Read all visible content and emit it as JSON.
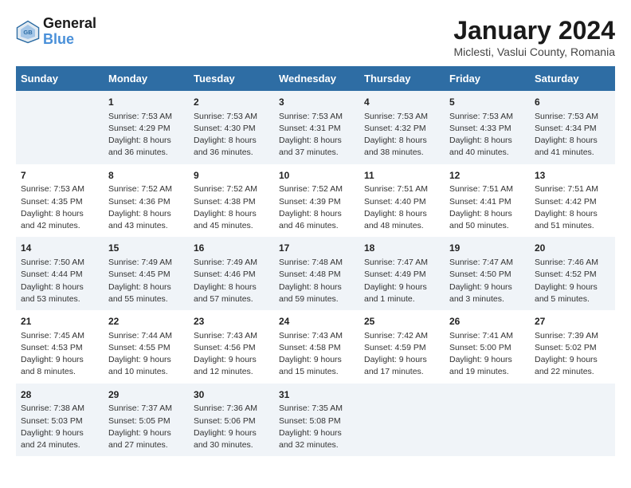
{
  "logo": {
    "line1": "General",
    "line2": "Blue"
  },
  "title": "January 2024",
  "subtitle": "Miclesti, Vaslui County, Romania",
  "header_color": "#2e6da4",
  "days_of_week": [
    "Sunday",
    "Monday",
    "Tuesday",
    "Wednesday",
    "Thursday",
    "Friday",
    "Saturday"
  ],
  "weeks": [
    [
      {
        "day": "",
        "info": ""
      },
      {
        "day": "1",
        "info": "Sunrise: 7:53 AM\nSunset: 4:29 PM\nDaylight: 8 hours\nand 36 minutes."
      },
      {
        "day": "2",
        "info": "Sunrise: 7:53 AM\nSunset: 4:30 PM\nDaylight: 8 hours\nand 36 minutes."
      },
      {
        "day": "3",
        "info": "Sunrise: 7:53 AM\nSunset: 4:31 PM\nDaylight: 8 hours\nand 37 minutes."
      },
      {
        "day": "4",
        "info": "Sunrise: 7:53 AM\nSunset: 4:32 PM\nDaylight: 8 hours\nand 38 minutes."
      },
      {
        "day": "5",
        "info": "Sunrise: 7:53 AM\nSunset: 4:33 PM\nDaylight: 8 hours\nand 40 minutes."
      },
      {
        "day": "6",
        "info": "Sunrise: 7:53 AM\nSunset: 4:34 PM\nDaylight: 8 hours\nand 41 minutes."
      }
    ],
    [
      {
        "day": "7",
        "info": "Sunrise: 7:53 AM\nSunset: 4:35 PM\nDaylight: 8 hours\nand 42 minutes."
      },
      {
        "day": "8",
        "info": "Sunrise: 7:52 AM\nSunset: 4:36 PM\nDaylight: 8 hours\nand 43 minutes."
      },
      {
        "day": "9",
        "info": "Sunrise: 7:52 AM\nSunset: 4:38 PM\nDaylight: 8 hours\nand 45 minutes."
      },
      {
        "day": "10",
        "info": "Sunrise: 7:52 AM\nSunset: 4:39 PM\nDaylight: 8 hours\nand 46 minutes."
      },
      {
        "day": "11",
        "info": "Sunrise: 7:51 AM\nSunset: 4:40 PM\nDaylight: 8 hours\nand 48 minutes."
      },
      {
        "day": "12",
        "info": "Sunrise: 7:51 AM\nSunset: 4:41 PM\nDaylight: 8 hours\nand 50 minutes."
      },
      {
        "day": "13",
        "info": "Sunrise: 7:51 AM\nSunset: 4:42 PM\nDaylight: 8 hours\nand 51 minutes."
      }
    ],
    [
      {
        "day": "14",
        "info": "Sunrise: 7:50 AM\nSunset: 4:44 PM\nDaylight: 8 hours\nand 53 minutes."
      },
      {
        "day": "15",
        "info": "Sunrise: 7:49 AM\nSunset: 4:45 PM\nDaylight: 8 hours\nand 55 minutes."
      },
      {
        "day": "16",
        "info": "Sunrise: 7:49 AM\nSunset: 4:46 PM\nDaylight: 8 hours\nand 57 minutes."
      },
      {
        "day": "17",
        "info": "Sunrise: 7:48 AM\nSunset: 4:48 PM\nDaylight: 8 hours\nand 59 minutes."
      },
      {
        "day": "18",
        "info": "Sunrise: 7:47 AM\nSunset: 4:49 PM\nDaylight: 9 hours\nand 1 minute."
      },
      {
        "day": "19",
        "info": "Sunrise: 7:47 AM\nSunset: 4:50 PM\nDaylight: 9 hours\nand 3 minutes."
      },
      {
        "day": "20",
        "info": "Sunrise: 7:46 AM\nSunset: 4:52 PM\nDaylight: 9 hours\nand 5 minutes."
      }
    ],
    [
      {
        "day": "21",
        "info": "Sunrise: 7:45 AM\nSunset: 4:53 PM\nDaylight: 9 hours\nand 8 minutes."
      },
      {
        "day": "22",
        "info": "Sunrise: 7:44 AM\nSunset: 4:55 PM\nDaylight: 9 hours\nand 10 minutes."
      },
      {
        "day": "23",
        "info": "Sunrise: 7:43 AM\nSunset: 4:56 PM\nDaylight: 9 hours\nand 12 minutes."
      },
      {
        "day": "24",
        "info": "Sunrise: 7:43 AM\nSunset: 4:58 PM\nDaylight: 9 hours\nand 15 minutes."
      },
      {
        "day": "25",
        "info": "Sunrise: 7:42 AM\nSunset: 4:59 PM\nDaylight: 9 hours\nand 17 minutes."
      },
      {
        "day": "26",
        "info": "Sunrise: 7:41 AM\nSunset: 5:00 PM\nDaylight: 9 hours\nand 19 minutes."
      },
      {
        "day": "27",
        "info": "Sunrise: 7:39 AM\nSunset: 5:02 PM\nDaylight: 9 hours\nand 22 minutes."
      }
    ],
    [
      {
        "day": "28",
        "info": "Sunrise: 7:38 AM\nSunset: 5:03 PM\nDaylight: 9 hours\nand 24 minutes."
      },
      {
        "day": "29",
        "info": "Sunrise: 7:37 AM\nSunset: 5:05 PM\nDaylight: 9 hours\nand 27 minutes."
      },
      {
        "day": "30",
        "info": "Sunrise: 7:36 AM\nSunset: 5:06 PM\nDaylight: 9 hours\nand 30 minutes."
      },
      {
        "day": "31",
        "info": "Sunrise: 7:35 AM\nSunset: 5:08 PM\nDaylight: 9 hours\nand 32 minutes."
      },
      {
        "day": "",
        "info": ""
      },
      {
        "day": "",
        "info": ""
      },
      {
        "day": "",
        "info": ""
      }
    ]
  ]
}
